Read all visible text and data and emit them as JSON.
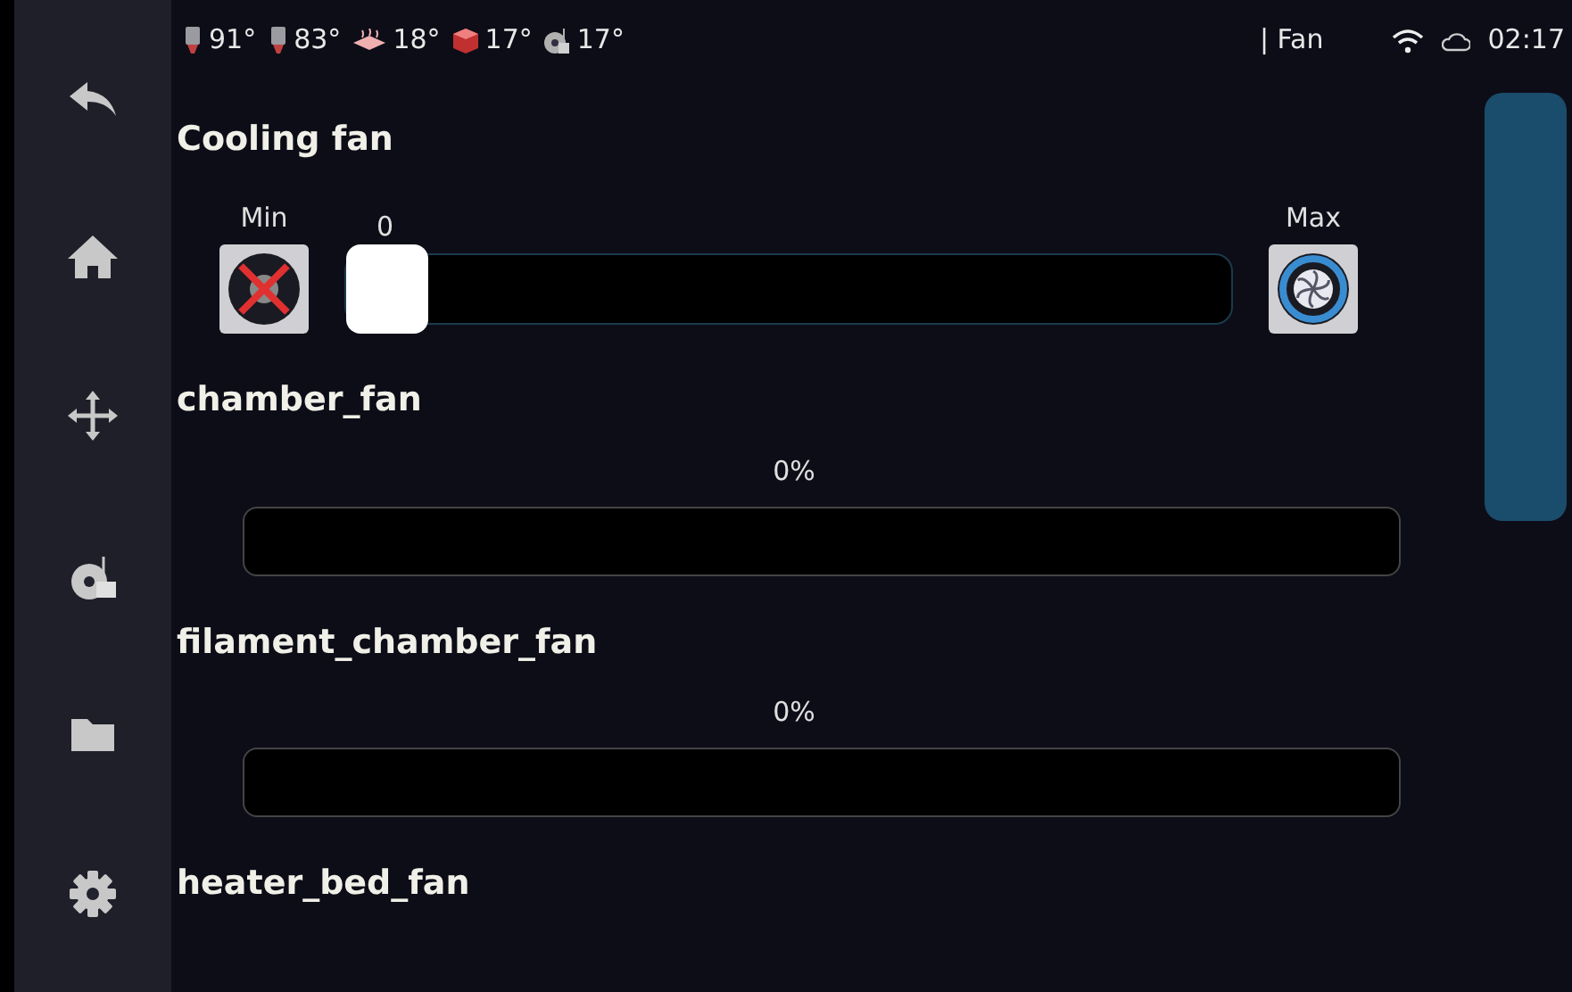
{
  "status_bar": {
    "temperatures": [
      {
        "kind": "nozzle",
        "value": "91°"
      },
      {
        "kind": "nozzle",
        "value": "83°"
      },
      {
        "kind": "bed",
        "value": "18°"
      },
      {
        "kind": "chamber",
        "value": "17°"
      },
      {
        "kind": "spool",
        "value": "17°"
      }
    ],
    "title": "| Fan",
    "time": "02:17"
  },
  "sidebar": {
    "items": [
      {
        "kind": "back"
      },
      {
        "kind": "home"
      },
      {
        "kind": "move"
      },
      {
        "kind": "spool"
      },
      {
        "kind": "folder"
      },
      {
        "kind": "settings"
      }
    ]
  },
  "fans": [
    {
      "kind": "slider",
      "name": "Cooling fan",
      "min_label": "Min",
      "max_label": "Max",
      "value": "0",
      "level": 0
    },
    {
      "kind": "bar",
      "name": "chamber_fan",
      "reading": "0%",
      "level": 0
    },
    {
      "kind": "bar",
      "name": "filament_chamber_fan",
      "reading": "0%",
      "level": 0
    },
    {
      "kind": "header",
      "name": "heater_bed_fan"
    }
  ]
}
